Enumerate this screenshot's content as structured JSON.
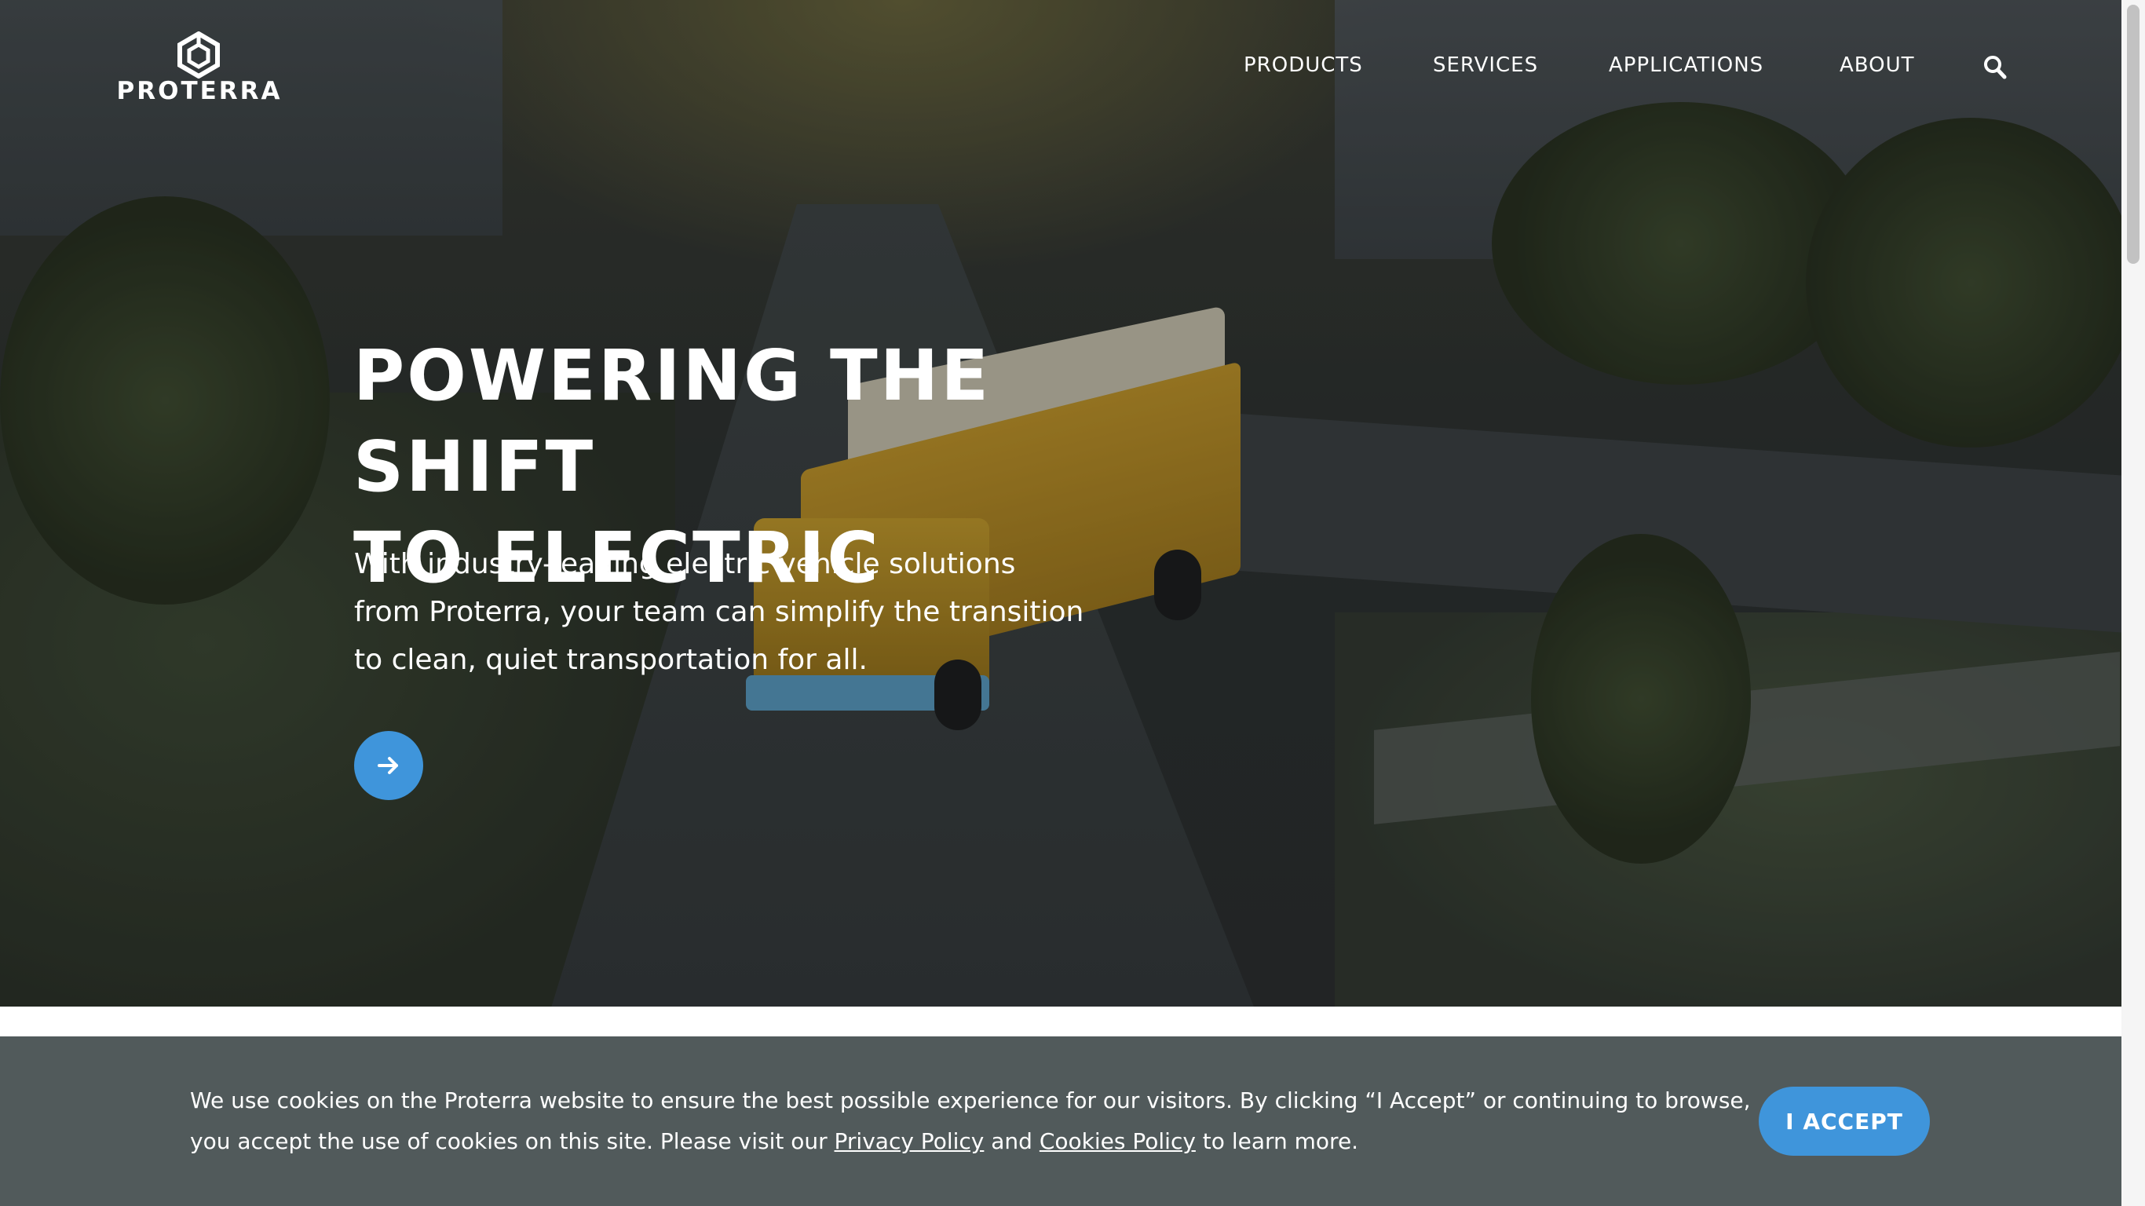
{
  "brand": {
    "name": "PROTERRA"
  },
  "nav": {
    "items": [
      "PRODUCTS",
      "SERVICES",
      "APPLICATIONS",
      "ABOUT"
    ],
    "search_icon": "search-icon"
  },
  "hero": {
    "headline_line1": "POWERING THE SHIFT",
    "headline_line2": "TO ELECTRIC",
    "body_line1": "With industry-leading electric vehicle solutions",
    "body_line2": "from Proterra, your team can simplify the transition",
    "body_line3": "to clean, quiet transportation for all.",
    "cta_icon": "arrow-right-icon"
  },
  "cookie_banner": {
    "text_part1": "We use cookies on the Proterra website to ensure the best possible experience for our visitors. By clicking “I Accept” or continuing to browse, you accept the use of cookies on this site. Please visit our ",
    "privacy_link": "Privacy Policy",
    "text_and": " and ",
    "cookies_link": "Cookies Policy",
    "text_part2": " to learn more.",
    "accept_label": "I ACCEPT"
  },
  "colors": {
    "accent": "#3f95db",
    "banner": "#515a5b",
    "text": "#ffffff"
  }
}
